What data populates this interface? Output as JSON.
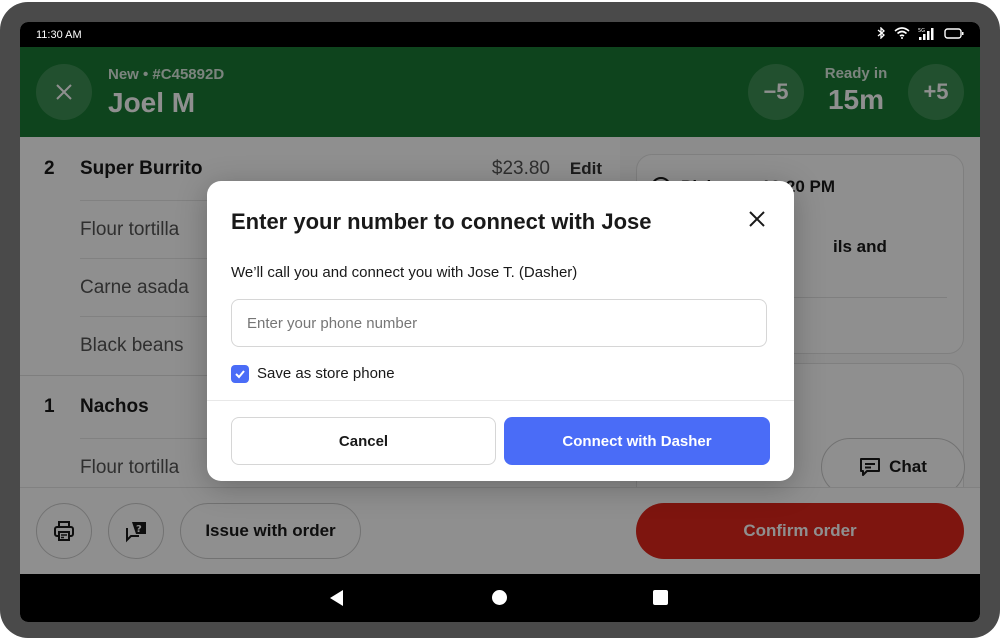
{
  "status_bar": {
    "time": "11:30 AM",
    "icons": [
      "bluetooth-icon",
      "wifi-icon",
      "signal-5g-icon",
      "battery-icon"
    ],
    "network_label": "5G"
  },
  "header": {
    "close_icon": "close-icon",
    "subtitle": "New • #C45892D",
    "customer_name": "Joel M",
    "decrease_label": "−5",
    "increase_label": "+5",
    "ready_label": "Ready in",
    "ready_value": "15m",
    "background_color": "#1a7a34"
  },
  "order": {
    "items": [
      {
        "qty": "2",
        "name": "Super Burrito",
        "price": "$23.80",
        "edit_label": "Edit",
        "modifiers": [
          "Flour tortilla",
          "Carne asada",
          "Black beans"
        ]
      },
      {
        "qty": "1",
        "name": "Nachos",
        "modifiers": [
          "Flour tortilla"
        ]
      }
    ]
  },
  "details": {
    "pickup_text": "Pickup at 12:20 PM",
    "note_fragment": "ils and",
    "chat_label": "Chat"
  },
  "bottom_bar": {
    "print_icon": "printer-icon",
    "help_icon": "help-chat-icon",
    "issue_label": "Issue with order",
    "confirm_label": "Confirm order",
    "confirm_color": "#e0261b"
  },
  "modal": {
    "title": "Enter your number to connect with Jose",
    "description": "We’ll call you and connect you with Jose T. (Dasher)",
    "phone_input": {
      "value": "",
      "placeholder": "Enter your phone number"
    },
    "save_checkbox": {
      "label": "Save as store phone",
      "checked": true
    },
    "cancel_label": "Cancel",
    "connect_label": "Connect with Dasher",
    "accent_color": "#4a6cf7"
  }
}
